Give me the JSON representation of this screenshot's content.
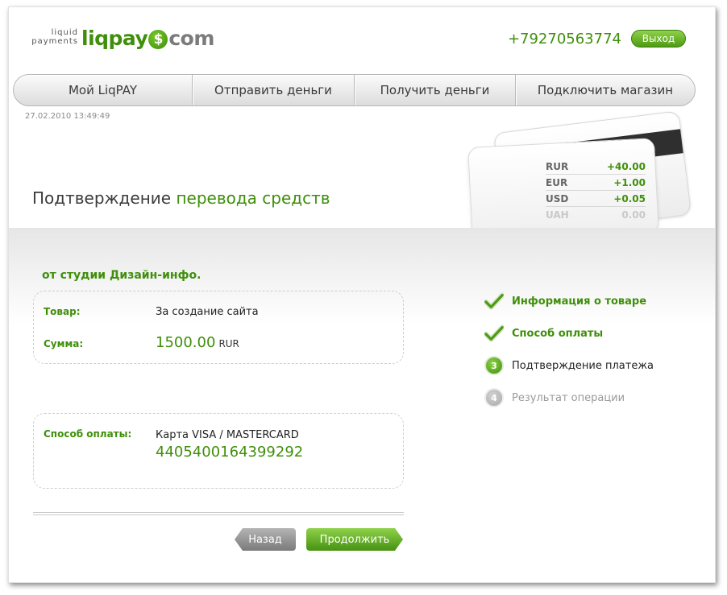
{
  "header": {
    "logo_tag_line1": "liquid",
    "logo_tag_line2": "payments",
    "logo_word_a": "liqpay",
    "logo_coin": "$",
    "logo_word_b": "com",
    "phone": "+79270563774",
    "logout_label": "Выход"
  },
  "nav": {
    "items": [
      {
        "label": "Мой LiqPAY"
      },
      {
        "label": "Отправить деньги"
      },
      {
        "label": "Получить деньги"
      },
      {
        "label": "Подключить магазин"
      }
    ]
  },
  "datetime": "27.02.2010  13:49:49",
  "title": {
    "part1": "Подтверждение",
    "part2": "перевода средств"
  },
  "balance": [
    {
      "currency": "RUR",
      "amount": "+40.00"
    },
    {
      "currency": "EUR",
      "amount": "+1.00"
    },
    {
      "currency": "USD",
      "amount": "+0.05"
    },
    {
      "currency": "UAH",
      "amount": "0.00"
    }
  ],
  "merchant": "от студии Дизайн-инфо.",
  "order": {
    "item_label": "Товар:",
    "item_value": "За создание сайта",
    "sum_label": "Сумма:",
    "sum_value": "1500.00",
    "sum_currency": "RUR"
  },
  "payment": {
    "method_label": "Способ оплаты:",
    "method_value": "Карта VISA / MASTERCARD",
    "card_number": "4405400164399292"
  },
  "buttons": {
    "back": "Назад",
    "continue": "Продолжить"
  },
  "steps": [
    {
      "label": "Информация о товаре",
      "state": "done"
    },
    {
      "label": "Способ оплаты",
      "state": "done"
    },
    {
      "label": "Подтверждение платежа",
      "state": "current",
      "number": "3"
    },
    {
      "label": "Результат операции",
      "state": "pending",
      "number": "4"
    }
  ],
  "colors": {
    "accent_green": "#3f8f0a",
    "muted_gray": "#9a9a9a"
  }
}
